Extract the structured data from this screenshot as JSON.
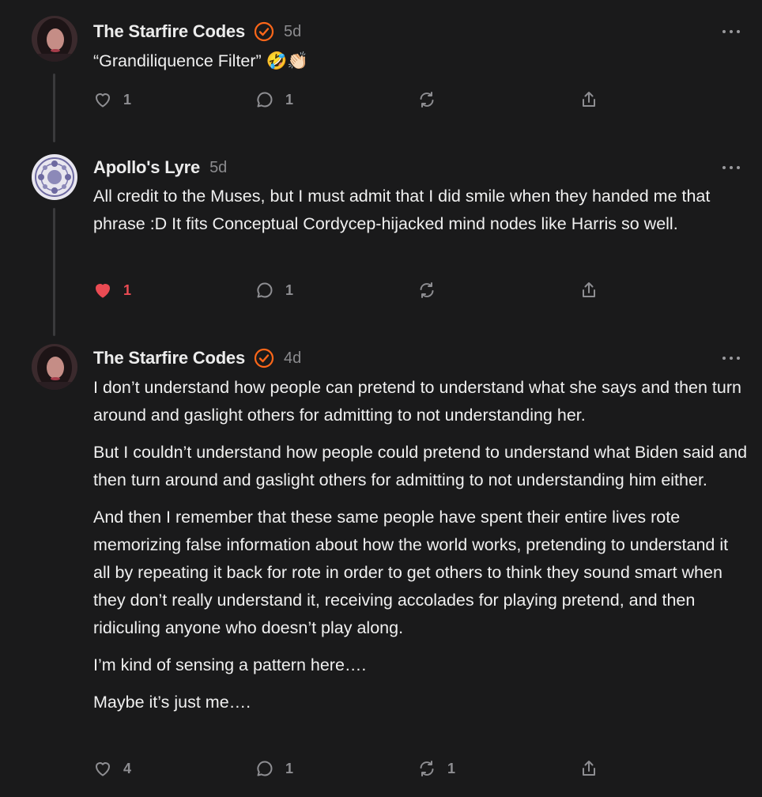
{
  "colors": {
    "background": "#1a1a1b",
    "accent_verified": "#ff6719",
    "liked": "#ea4b53",
    "muted": "#8e8e92"
  },
  "comments": [
    {
      "author": "The Starfire Codes",
      "verified": true,
      "time": "5d",
      "paragraphs": [
        "“Grandiliquence Filter” 🤣👏🏻"
      ],
      "likes": "1",
      "liked": false,
      "replies": "1",
      "restacks": ""
    },
    {
      "author": "Apollo's Lyre",
      "verified": false,
      "time": "5d",
      "paragraphs": [
        "All credit to the Muses, but I must admit that I did smile when they handed me that phrase :D It fits Conceptual Cordycep-hijacked mind nodes like Harris so well."
      ],
      "likes": "1",
      "liked": true,
      "replies": "1",
      "restacks": ""
    },
    {
      "author": "The Starfire Codes",
      "verified": true,
      "time": "4d",
      "paragraphs": [
        "I don’t understand how people can pretend to understand what she says and then turn around and gaslight others for admitting to not understanding her.",
        "But I couldn’t understand how people could pretend to understand what Biden said and then turn around and gaslight others for admitting to not understanding him either.",
        "And then I remember that these same people have spent their entire lives rote memorizing false information about how the world works, pretending to understand it all by repeating it back for rote in order to get others to think they sound smart when they don’t really understand it, receiving accolades for playing pretend, and then ridiculing anyone who doesn’t play along.",
        "I’m kind of sensing a pattern here….",
        "Maybe it’s just me…."
      ],
      "likes": "4",
      "liked": false,
      "replies": "1",
      "restacks": "1"
    }
  ]
}
